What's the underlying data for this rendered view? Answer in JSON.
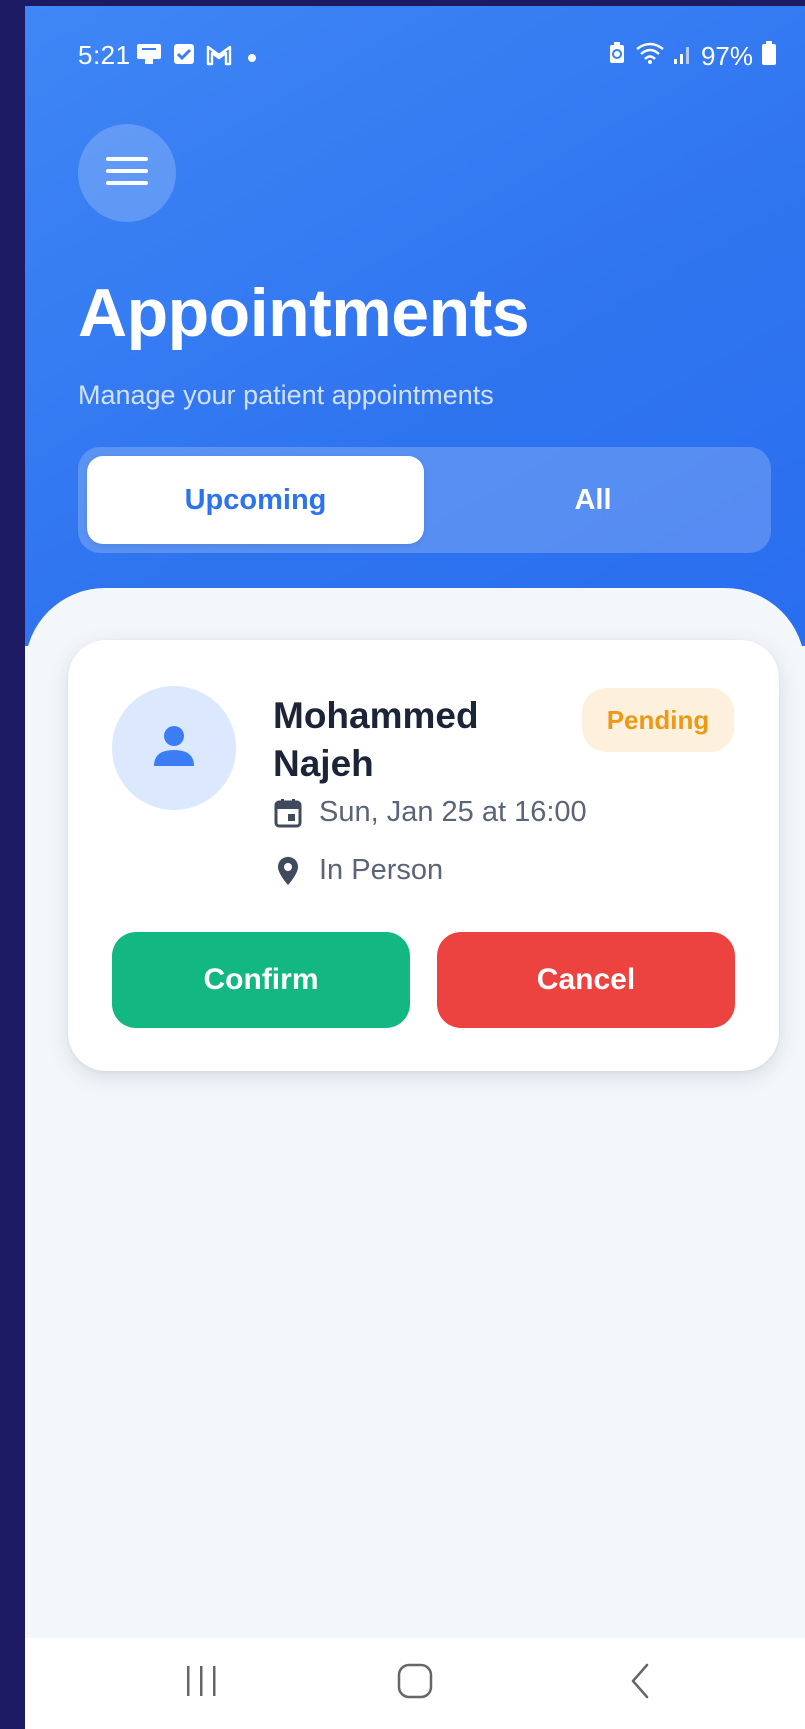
{
  "status_bar": {
    "time": "5:21",
    "battery": "97%",
    "left_icons": [
      "screen-cast-icon",
      "checkbox-icon",
      "gmail-icon",
      "dot-icon"
    ],
    "right_icons": [
      "battery-saver-icon",
      "wifi-icon",
      "signal-icon",
      "battery-icon"
    ]
  },
  "header": {
    "menu_icon": "hamburger-menu-icon",
    "title": "Appointments",
    "subtitle": "Manage your patient appointments"
  },
  "tabs": [
    {
      "label": "Upcoming",
      "active": true
    },
    {
      "label": "All",
      "active": false
    }
  ],
  "appointments": [
    {
      "patient_name": "Mohammed Najeh",
      "status": "Pending",
      "datetime": "Sun, Jan 25 at 16:00",
      "location": "In Person",
      "avatar_icon": "person-icon",
      "actions": {
        "confirm": "Confirm",
        "cancel": "Cancel"
      }
    }
  ],
  "colors": {
    "header_bg": "#3480f3",
    "accent": "#2d72ee",
    "confirm": "#13b781",
    "cancel": "#ec4341",
    "pending_text": "#ea9a17",
    "pending_bg": "#fdf1de",
    "frame": "#1c1a62"
  },
  "nav_bar": {
    "icons": [
      "recent-apps-icon",
      "home-icon",
      "back-icon"
    ]
  }
}
